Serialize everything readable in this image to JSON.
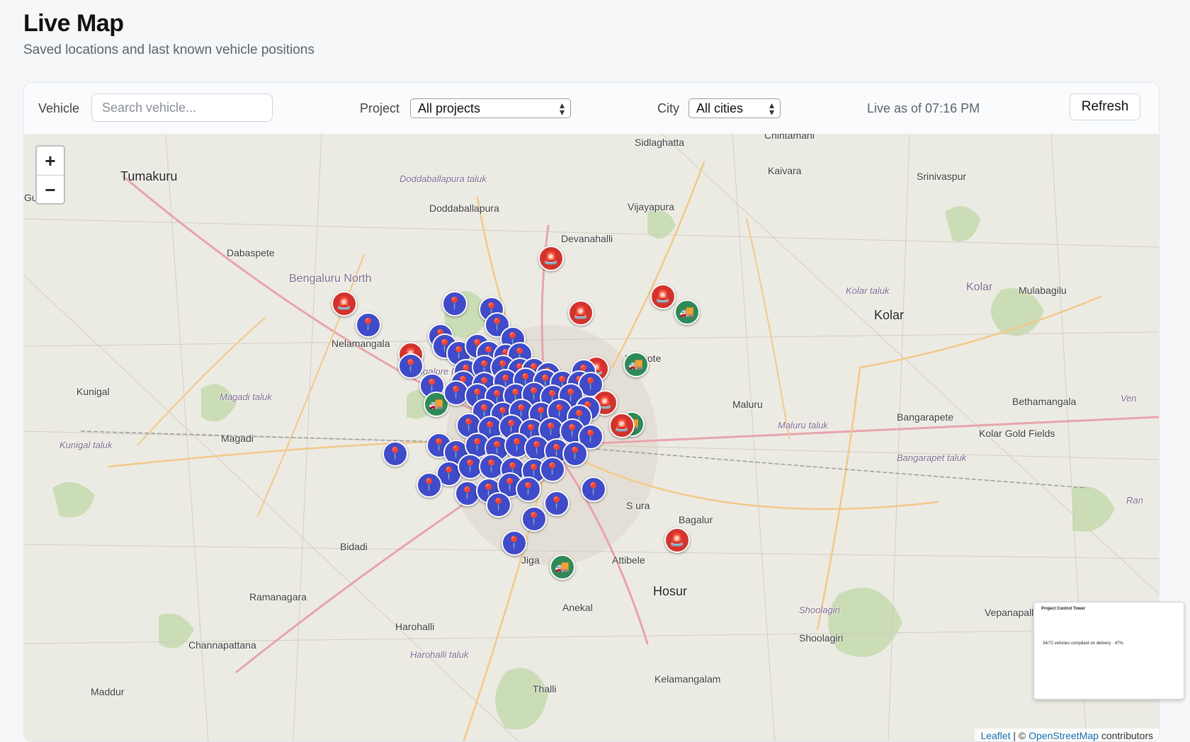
{
  "header": {
    "title": "Live Map",
    "subtitle": "Saved locations and last known vehicle positions"
  },
  "toolbar": {
    "vehicle_label": "Vehicle",
    "vehicle_placeholder": "Search vehicle...",
    "project_label": "Project",
    "project_value": "All projects",
    "city_label": "City",
    "city_value": "All cities",
    "live_status": "Live as of 07:16 PM",
    "refresh_label": "Refresh"
  },
  "map": {
    "zoom_in": "+",
    "zoom_out": "−",
    "attribution_leaflet": "Leaflet",
    "attribution_sep": " | © ",
    "attribution_osm": "OpenStreetMap",
    "attribution_tail": " contributors",
    "places": {
      "tumakuru": "Tumakuru",
      "sidlaghatta": "Sidlaghatta",
      "chintamani": "Chintamani",
      "kaivara": "Kaivara",
      "srinivaspur": "Srinivaspur",
      "doddaballapura_taluk": "Doddaballapura taluk",
      "doddaballapura": "Doddaballapura",
      "vijayapura": "Vijayapura",
      "devanahalli": "Devanahalli",
      "dabaspete": "Dabaspete",
      "bengaluru_north": "Bengaluru North",
      "kolar_region": "Kolar",
      "kolar_taluk": "Kolar taluk",
      "kolar": "Kolar",
      "mulabagilu": "Mulabagilu",
      "nelamangala": "Nelamangala",
      "hoskote": "Hoskote",
      "kunigal": "Kunigal",
      "magadi_taluk": "Magadi taluk",
      "maluru": "Maluru",
      "bangarapete": "Bangarapete",
      "bethamangala": "Bethamangala",
      "magadi": "Magadi",
      "kunigal_taluk": "Kunigal taluk",
      "maluru_taluk": "Maluru taluk",
      "kolar_gold_fields": "Kolar Gold Fields",
      "bangarapet_taluk": "Bangarapet taluk",
      "bagalur": "Bagalur",
      "bidadi": "Bidadi",
      "attibele": "Attibele",
      "ramanagara": "Ramanagara",
      "hosur": "Hosur",
      "anekal": "Anekal",
      "shoolagiri_region": "Shoolagiri",
      "vepanapalli": "Vepanapalli",
      "harohalli": "Harohalli",
      "shoolagiri": "Shoolagiri",
      "channapattana": "Channapattana",
      "harohalli_taluk": "Harohalli taluk",
      "kelamangalam": "Kelamangalam",
      "maddur": "Maddur",
      "thalli": "Thalli",
      "gubbi": "Gub",
      "venkat": "Ven",
      "ran": "Ran",
      "bangalore_north": "Bangalore North",
      "jigani": "Jiga",
      "sarjapura": "S   ura"
    }
  },
  "markers": {
    "location_icon": "map-pin-icon",
    "alert_icon": "alert-siren-icon",
    "vehicle_icon": "truck-icon",
    "colors": {
      "location": "#3f4bc9",
      "alert": "#d2332d",
      "vehicle": "#2e8b57"
    }
  },
  "thumbnail": {
    "title": "Project Control Tower",
    "line": "34/72 vehicles compliant on delivery · 47%"
  }
}
